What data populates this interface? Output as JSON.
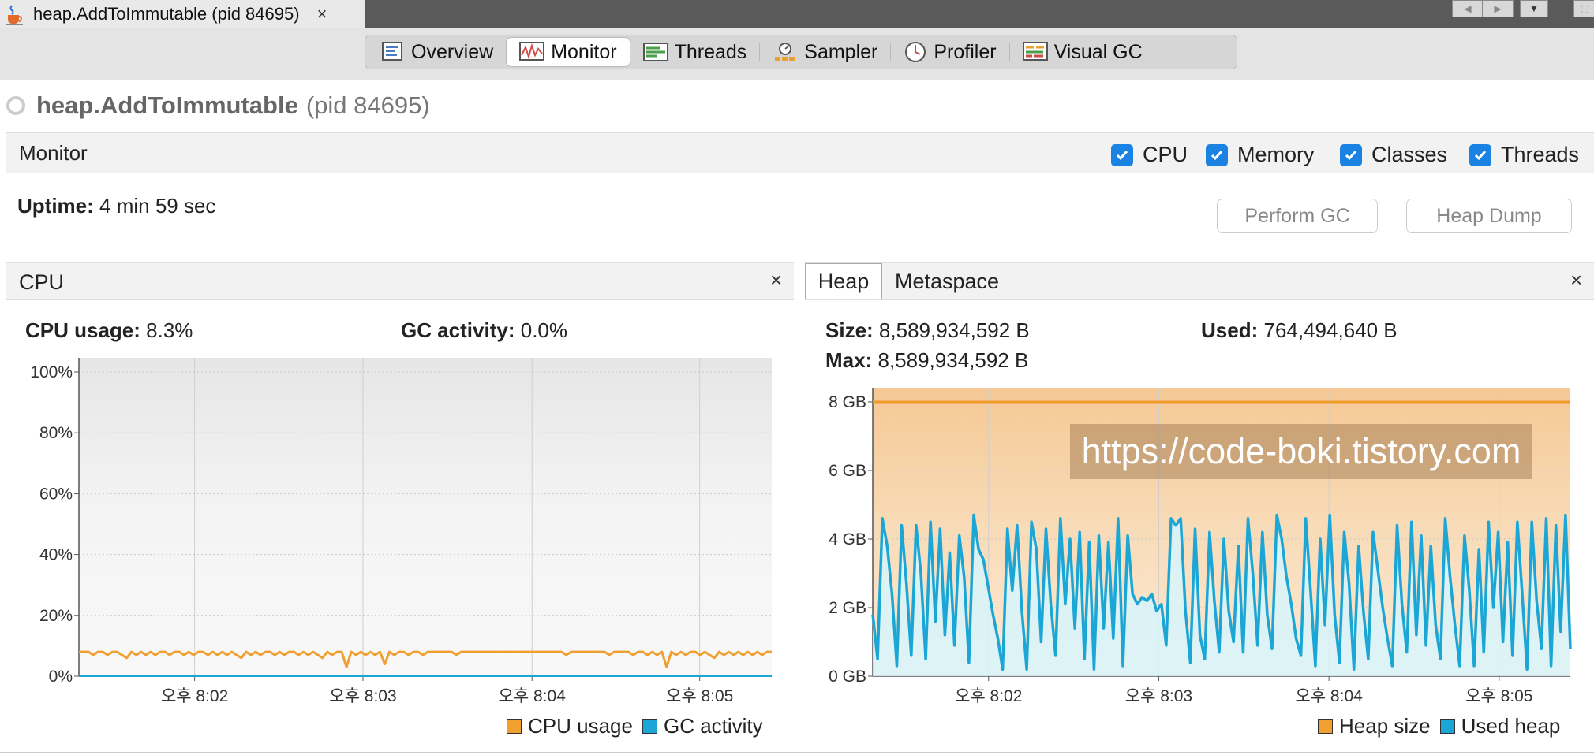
{
  "window": {
    "tab_title": "heap.AddToImmutable (pid 84695)",
    "tab_close": "×"
  },
  "views": [
    {
      "label": "Overview",
      "icon": "overview-icon",
      "active": false
    },
    {
      "label": "Monitor",
      "icon": "monitor-icon",
      "active": true
    },
    {
      "label": "Threads",
      "icon": "threads-icon",
      "active": false
    },
    {
      "label": "Sampler",
      "icon": "sampler-icon",
      "active": false
    },
    {
      "label": "Profiler",
      "icon": "profiler-icon",
      "active": false
    },
    {
      "label": "Visual GC",
      "icon": "visual-gc-icon",
      "active": false
    }
  ],
  "app": {
    "name": "heap.AddToImmutable",
    "pid": "(pid 84695)"
  },
  "monitor": {
    "title": "Monitor",
    "checks": [
      {
        "label": "CPU",
        "checked": true
      },
      {
        "label": "Memory",
        "checked": true
      },
      {
        "label": "Classes",
        "checked": true
      },
      {
        "label": "Threads",
        "checked": true
      }
    ],
    "uptime_label": "Uptime:",
    "uptime_value": "4 min 59 sec",
    "perform_gc": "Perform GC",
    "heap_dump": "Heap Dump"
  },
  "cpu_panel": {
    "title": "CPU",
    "close": "×",
    "usage_label": "CPU usage:",
    "usage_value": "8.3%",
    "gc_label": "GC activity:",
    "gc_value": "0.0%",
    "legend": [
      {
        "label": "CPU usage",
        "color": "#f0a030"
      },
      {
        "label": "GC activity",
        "color": "#1ba6d6"
      }
    ]
  },
  "heap_panel": {
    "tabs": [
      {
        "label": "Heap",
        "active": true
      },
      {
        "label": "Metaspace",
        "active": false
      }
    ],
    "close": "×",
    "size_label": "Size:",
    "size_value": "8,589,934,592 B",
    "used_label": "Used:",
    "used_value": "764,494,640 B",
    "max_label": "Max:",
    "max_value": "8,589,934,592 B",
    "watermark": "https://code-boki.tistory.com",
    "legend": [
      {
        "label": "Heap size",
        "color": "#f0a030"
      },
      {
        "label": "Used heap",
        "color": "#1ba6d6"
      }
    ]
  },
  "chart_data": [
    {
      "type": "line",
      "yticks": [
        "100%",
        "80%",
        "60%",
        "40%",
        "20%",
        "0%"
      ],
      "ylim": [
        0,
        100
      ],
      "xticks": [
        "오후 8:02",
        "오후 8:03",
        "오후 8:04",
        "오후 8:05"
      ],
      "series": [
        {
          "name": "CPU usage",
          "values": [
            8,
            8,
            8,
            7,
            8,
            8,
            7,
            8,
            8,
            7,
            6,
            8,
            7,
            8,
            7,
            8,
            7,
            8,
            8,
            7,
            8,
            8,
            7,
            8,
            7,
            8,
            8,
            7,
            8,
            7,
            8,
            7,
            8,
            7,
            6,
            8,
            7,
            8,
            7,
            8,
            8,
            7,
            8,
            7,
            8,
            8,
            7,
            8,
            7,
            8,
            7,
            6,
            8,
            7,
            8,
            8,
            3,
            8,
            7,
            8,
            7,
            8,
            7,
            8,
            4,
            8,
            7,
            8,
            8,
            7,
            8,
            8,
            7,
            8,
            8,
            8,
            8,
            8,
            8,
            7,
            8,
            8,
            8,
            8,
            8,
            8,
            8,
            8,
            8,
            8,
            8,
            8,
            8,
            8,
            8,
            8,
            8,
            8,
            8,
            8,
            8,
            8,
            7,
            8,
            8,
            8,
            8,
            8,
            8,
            8,
            8,
            7,
            8,
            8,
            8,
            8,
            7,
            8,
            8,
            7,
            8,
            7,
            8,
            3,
            8,
            7,
            8,
            7,
            8,
            8,
            7,
            8,
            7,
            6,
            8,
            7,
            8,
            7,
            8,
            7,
            8,
            7,
            8,
            7,
            8,
            8
          ]
        },
        {
          "name": "GC activity",
          "values": [
            0,
            0,
            0,
            0,
            0,
            0,
            0,
            0,
            0,
            0,
            0,
            0,
            0,
            0,
            0,
            0,
            0,
            0,
            0,
            0,
            0,
            0,
            0,
            0,
            0,
            0,
            0,
            0,
            0,
            0
          ]
        }
      ]
    },
    {
      "type": "area",
      "yticks": [
        "8 GB",
        "6 GB",
        "4 GB",
        "2 GB",
        "0 GB"
      ],
      "ylim": [
        0,
        8
      ],
      "xticks": [
        "오후 8:02",
        "오후 8:03",
        "오후 8:04",
        "오후 8:05"
      ],
      "series": [
        {
          "name": "Heap size",
          "values": [
            8,
            8
          ]
        },
        {
          "name": "Used heap",
          "values": [
            1.8,
            0.5,
            4.6,
            3.8,
            2.4,
            0.3,
            4.4,
            2.7,
            0.6,
            4.4,
            3.0,
            0.5,
            4.5,
            1.6,
            4.3,
            1.2,
            3.6,
            0.9,
            4.1,
            2.9,
            0.4,
            4.7,
            3.7,
            3.4,
            2.6,
            1.8,
            1.1,
            0.2,
            4.3,
            2.5,
            4.4,
            1.9,
            0.2,
            4.5,
            3.7,
            1.0,
            4.3,
            2.1,
            0.6,
            4.6,
            2.1,
            4.0,
            1.4,
            4.2,
            0.5,
            3.9,
            0.2,
            4.1,
            1.4,
            3.9,
            1.1,
            4.6,
            0.3,
            4.1,
            2.4,
            2.1,
            2.3,
            2.2,
            2.4,
            1.9,
            2.1,
            0.9,
            4.6,
            4.4,
            4.6,
            1.9,
            0.4,
            4.3,
            1.2,
            0.5,
            4.2,
            2.2,
            0.7,
            4.0,
            1.9,
            1.0,
            3.8,
            0.7,
            4.6,
            3.0,
            0.9,
            4.2,
            1.8,
            0.8,
            4.7,
            4.0,
            2.9,
            2.1,
            1.1,
            0.6,
            4.6,
            2.5,
            0.3,
            4.0,
            1.5,
            4.7,
            1.8,
            0.4,
            4.2,
            2.7,
            0.2,
            3.8,
            1.9,
            0.5,
            4.2,
            3.1,
            2.0,
            1.1,
            0.3,
            4.4,
            2.1,
            0.7,
            4.5,
            1.2,
            4.1,
            0.9,
            3.8,
            1.5,
            0.5,
            4.6,
            2.9,
            1.5,
            0.3,
            4.1,
            2.5,
            0.3,
            3.7,
            0.7,
            4.5,
            2.0,
            4.2,
            1.0,
            3.9,
            0.6,
            4.5,
            2.4,
            0.2,
            4.5,
            2.2,
            0.8,
            4.6,
            0.3,
            4.4,
            1.3,
            4.7,
            0.8
          ]
        }
      ]
    }
  ]
}
